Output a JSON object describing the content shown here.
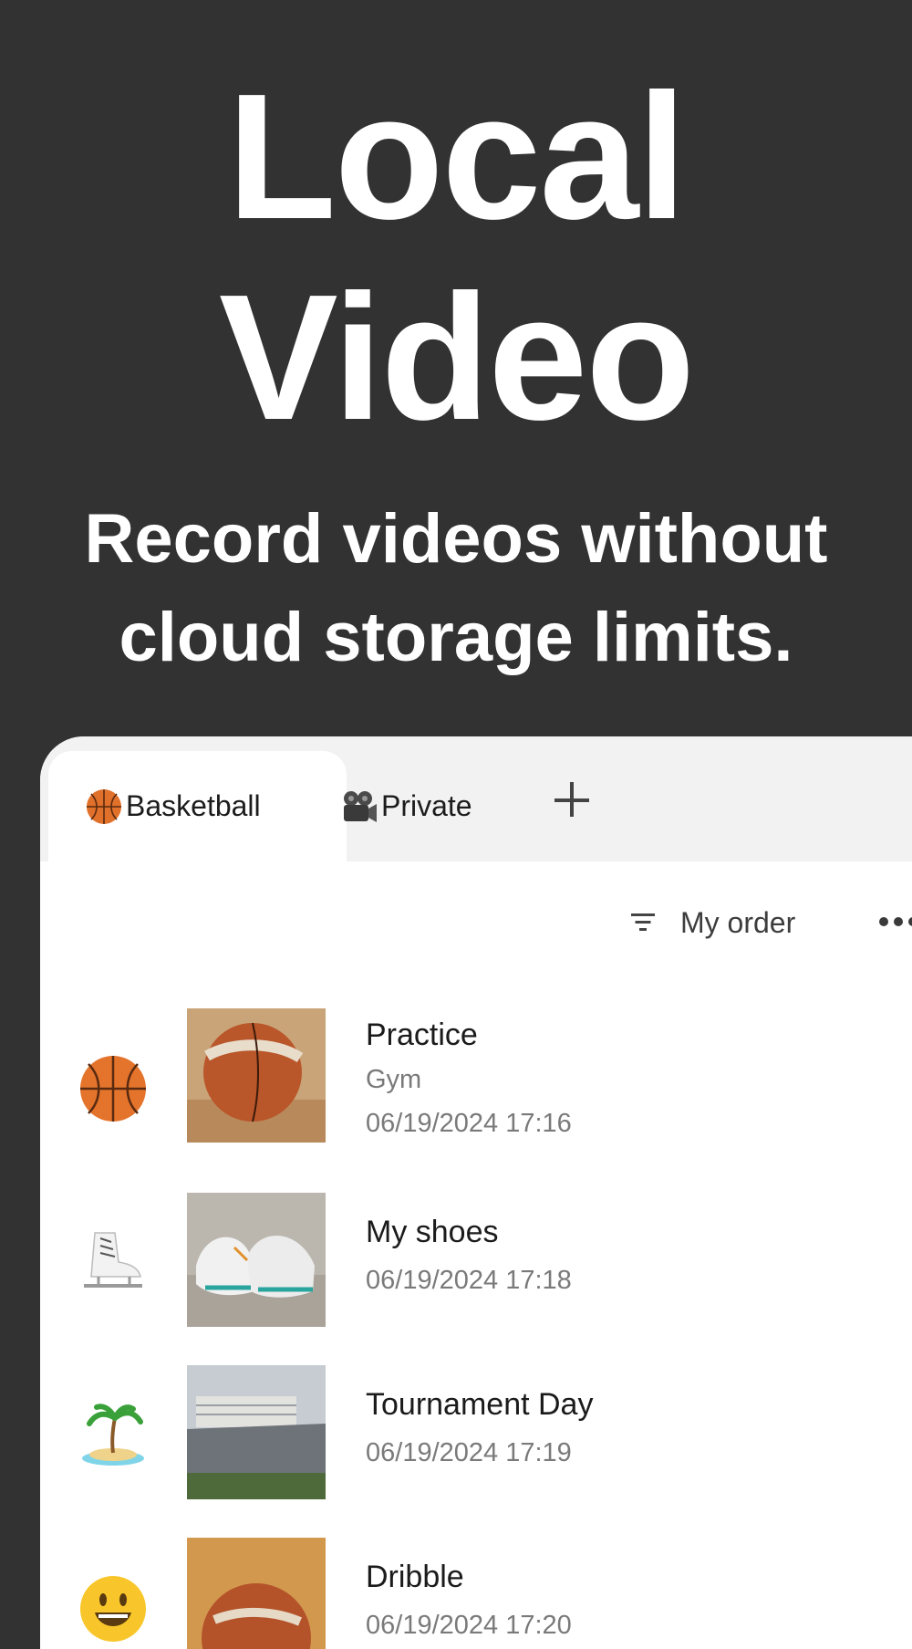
{
  "headline": {
    "line1": "Local",
    "line2": "Video"
  },
  "subheadline": {
    "line1": "Record videos without",
    "line2": "cloud storage limits."
  },
  "tabs": [
    {
      "label": "Basketball",
      "icon": "basketball-emoji",
      "active": true
    },
    {
      "label": "Private",
      "icon": "movie-camera-emoji",
      "active": false
    }
  ],
  "toolbar": {
    "sort_label": "My order",
    "sort_icon": "filter-icon",
    "more_icon": "more-icon",
    "add_tab_icon": "plus-icon"
  },
  "videos": [
    {
      "emoji": "basketball",
      "title": "Practice",
      "location": "Gym",
      "date": "06/19/2024 17:16",
      "thumbnail": "basketball-on-wooden-floor"
    },
    {
      "emoji": "ice-skate",
      "title": "My shoes",
      "date": "06/19/2024 17:18",
      "thumbnail": "white-sneakers"
    },
    {
      "emoji": "desert-island",
      "title": "Tournament Day",
      "date": "06/19/2024 17:19",
      "thumbnail": "building-rooftop"
    },
    {
      "emoji": "smiley",
      "title": "Dribble",
      "date": "06/19/2024 17:20",
      "thumbnail": "basketball-close-up"
    }
  ],
  "colors": {
    "background": "#323232",
    "panel": "#ffffff",
    "tabbar": "#f2f2f2",
    "text_primary": "#1b1b1b",
    "text_secondary": "#7a7a7a"
  }
}
